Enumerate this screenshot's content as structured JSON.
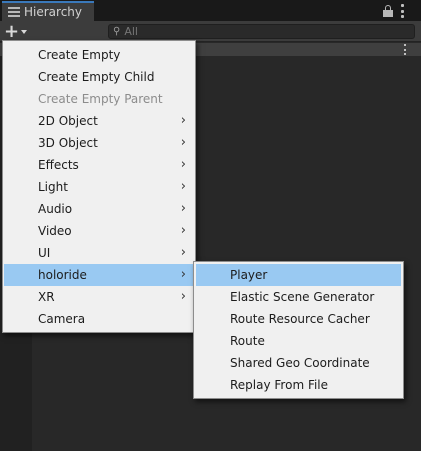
{
  "window": {
    "tab_title": "Hierarchy",
    "icons": {
      "tab": "hierarchy-list-icon",
      "lock": "lock-icon",
      "menu": "kebab-menu-icon"
    }
  },
  "toolbar": {
    "add_label": "+",
    "search_placeholder": "All"
  },
  "create_menu": {
    "items": [
      {
        "label": "Create Empty",
        "has_submenu": false,
        "state": "normal"
      },
      {
        "label": "Create Empty Child",
        "has_submenu": false,
        "state": "normal"
      },
      {
        "label": "Create Empty Parent",
        "has_submenu": false,
        "state": "disabled"
      },
      {
        "label": "2D Object",
        "has_submenu": true,
        "state": "normal"
      },
      {
        "label": "3D Object",
        "has_submenu": true,
        "state": "normal"
      },
      {
        "label": "Effects",
        "has_submenu": true,
        "state": "normal"
      },
      {
        "label": "Light",
        "has_submenu": true,
        "state": "normal"
      },
      {
        "label": "Audio",
        "has_submenu": true,
        "state": "normal"
      },
      {
        "label": "Video",
        "has_submenu": true,
        "state": "normal"
      },
      {
        "label": "UI",
        "has_submenu": true,
        "state": "normal"
      },
      {
        "label": "holoride",
        "has_submenu": true,
        "state": "highlighted"
      },
      {
        "label": "XR",
        "has_submenu": true,
        "state": "normal"
      },
      {
        "label": "Camera",
        "has_submenu": false,
        "state": "normal"
      }
    ],
    "submenu_arrow": "›"
  },
  "holoride_menu": {
    "items": [
      {
        "label": "Player",
        "state": "highlighted"
      },
      {
        "label": "Elastic Scene Generator",
        "state": "normal"
      },
      {
        "label": "Route Resource Cacher",
        "state": "normal"
      },
      {
        "label": "Route",
        "state": "normal"
      },
      {
        "label": "Shared Geo Coordinate",
        "state": "normal"
      },
      {
        "label": "Replay From File",
        "state": "normal"
      }
    ]
  },
  "colors": {
    "highlight": "#99c9f2",
    "menu_bg": "#f0f0f0",
    "panel_bg": "#282828",
    "tab_accent": "#3a79bb"
  }
}
